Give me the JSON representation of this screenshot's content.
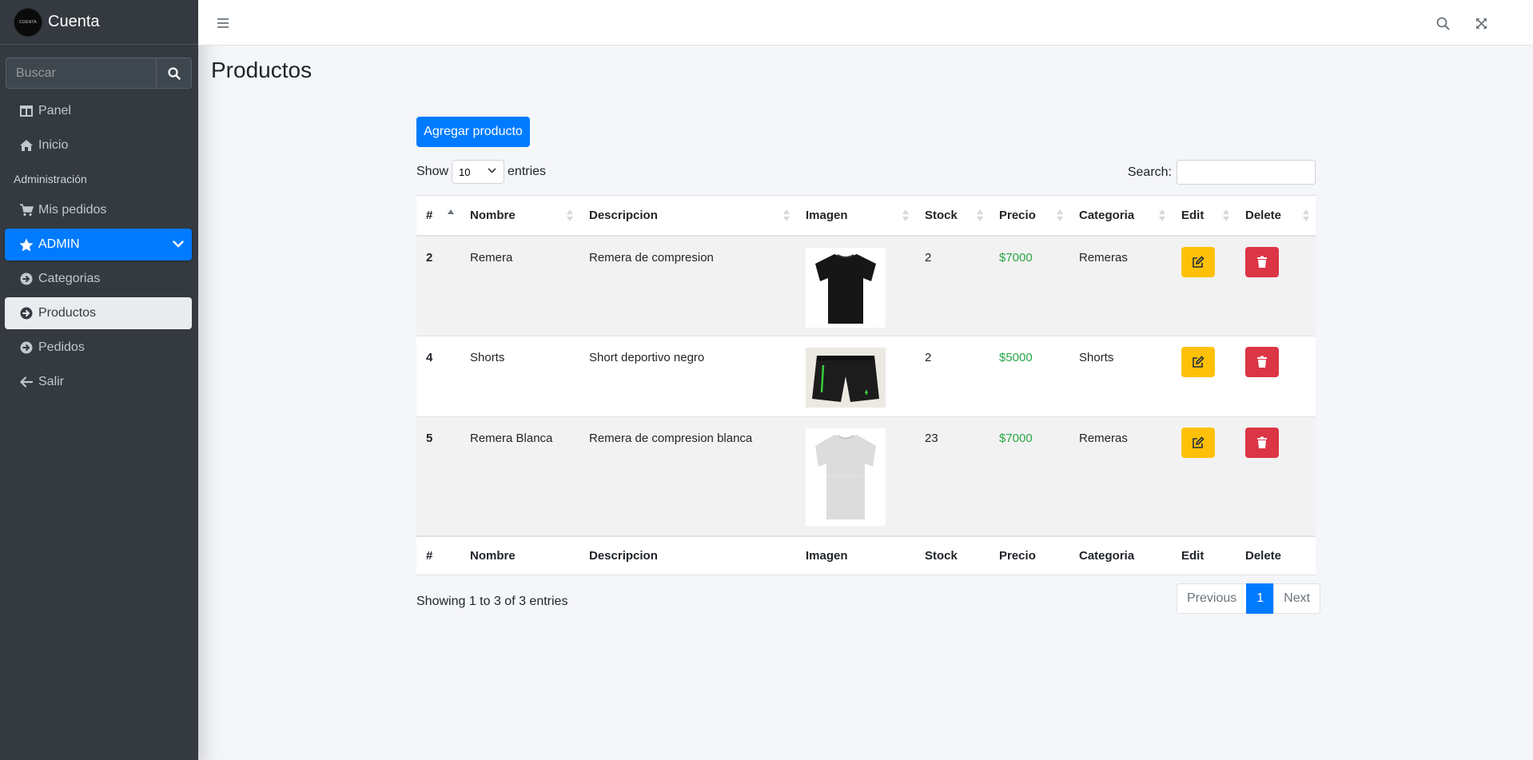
{
  "brand": {
    "name": "Cuenta",
    "logo_text": "CUENTA"
  },
  "sidebar": {
    "search_placeholder": "Buscar",
    "items": [
      {
        "label": "Panel",
        "icon": "columns-icon"
      },
      {
        "label": "Inicio",
        "icon": "home-icon"
      }
    ],
    "section_header": "Administración",
    "items2": [
      {
        "label": "Mis pedidos",
        "icon": "cart-icon"
      },
      {
        "label": "ADMIN",
        "icon": "star-icon"
      },
      {
        "label": "Categorias",
        "icon": "arrow-circle-icon"
      },
      {
        "label": "Productos",
        "icon": "arrow-circle-icon"
      },
      {
        "label": "Pedidos",
        "icon": "arrow-circle-icon"
      },
      {
        "label": "Salir",
        "icon": "arrow-left-icon"
      }
    ]
  },
  "page": {
    "title": "Productos",
    "add_button": "Agregar producto"
  },
  "table_controls": {
    "show_label": "Show",
    "entries_label": "entries",
    "page_length": "10",
    "search_label": "Search:"
  },
  "table": {
    "columns": [
      "#",
      "Nombre",
      "Descripcion",
      "Imagen",
      "Stock",
      "Precio",
      "Categoria",
      "Edit",
      "Delete"
    ],
    "rows": [
      {
        "id": "2",
        "nombre": "Remera",
        "descripcion": "Remera de compresion",
        "imagen": "black-tshirt-image",
        "stock": "2",
        "precio": "$7000",
        "categoria": "Remeras"
      },
      {
        "id": "4",
        "nombre": "Shorts",
        "descripcion": "Short deportivo negro",
        "imagen": "black-shorts-image",
        "stock": "2",
        "precio": "$5000",
        "categoria": "Shorts"
      },
      {
        "id": "5",
        "nombre": "Remera Blanca",
        "descripcion": "Remera de compresion blanca",
        "imagen": "white-tshirt-image",
        "stock": "23",
        "precio": "$7000",
        "categoria": "Remeras"
      }
    ]
  },
  "footer_info": "Showing 1 to 3 of 3 entries",
  "pagination": {
    "previous": "Previous",
    "current": "1",
    "next": "Next"
  },
  "colors": {
    "sidebar_bg": "#343a40",
    "primary": "#007bff",
    "warning": "#ffc107",
    "danger": "#dc3545",
    "success": "#28a745"
  }
}
